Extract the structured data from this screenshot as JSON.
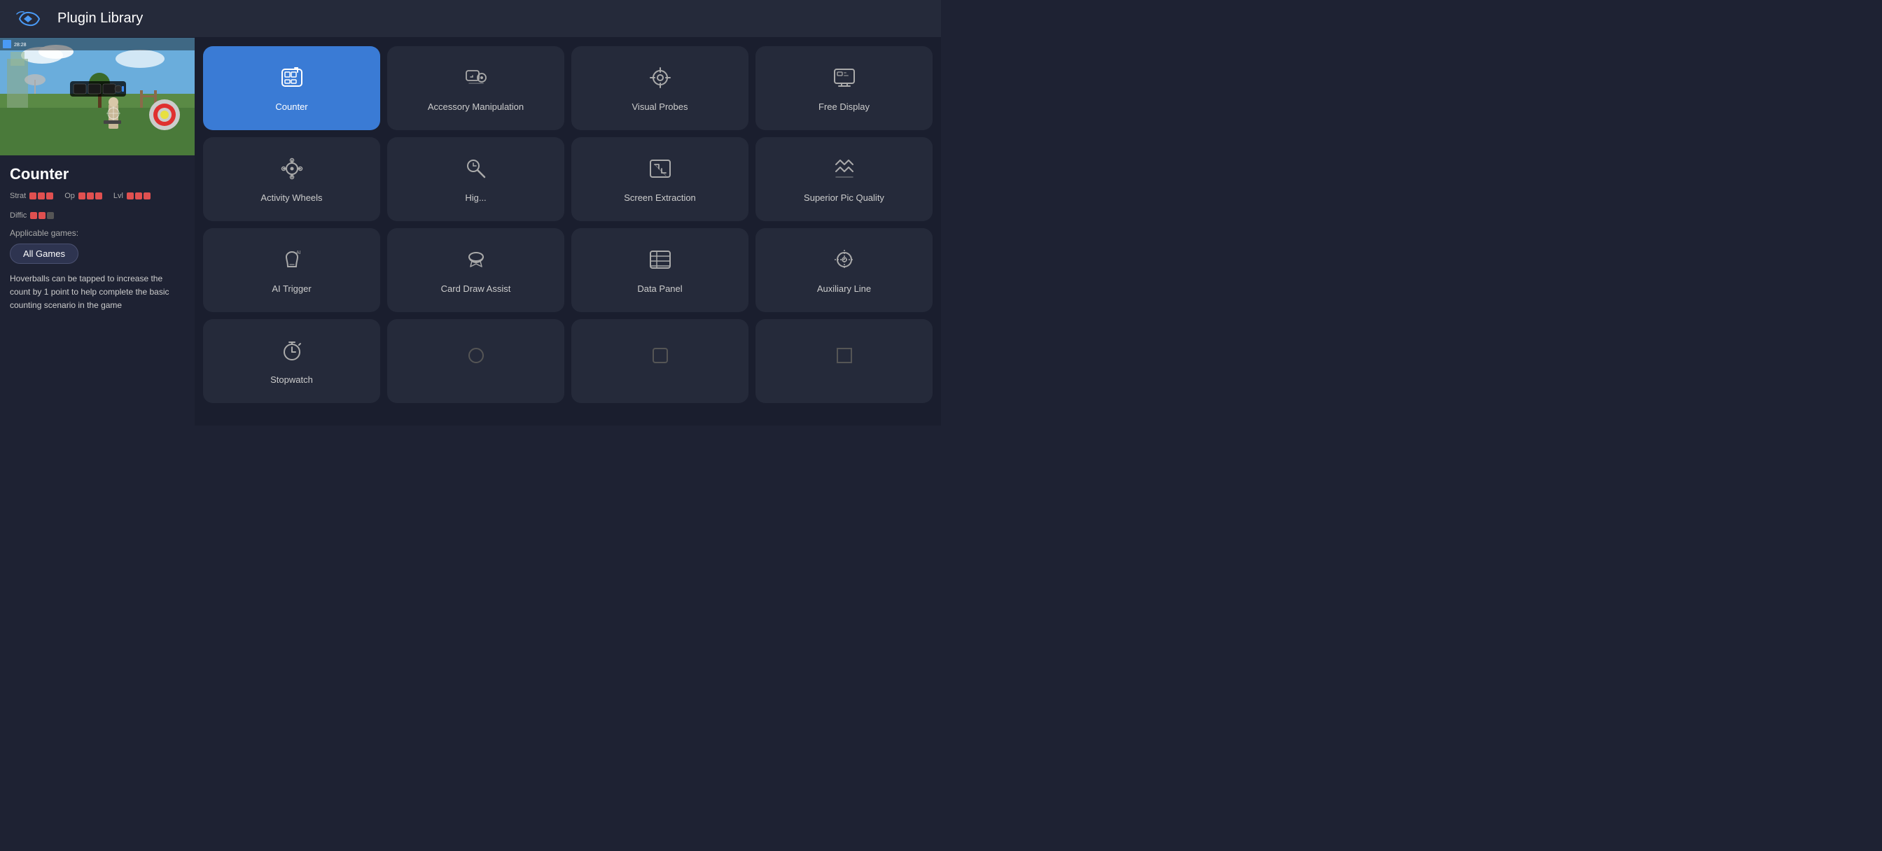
{
  "header": {
    "title": "Plugin Library"
  },
  "left": {
    "plugin_title": "Counter",
    "ratings": [
      {
        "label": "Strat",
        "dots": [
          true,
          true,
          true,
          false,
          false
        ]
      },
      {
        "label": "Op",
        "dots": [
          true,
          true,
          true,
          false,
          false
        ]
      },
      {
        "label": "Lvl",
        "dots": [
          true,
          true,
          true,
          false,
          false
        ]
      },
      {
        "label": "Diffic",
        "dots": [
          true,
          true,
          false,
          false,
          false
        ]
      }
    ],
    "applicable_label": "Applicable games:",
    "all_games_btn": "All Games",
    "description": "Hoverballs can be tapped to increase the count by 1 point to help complete the basic counting scenario in the game"
  },
  "grid": {
    "plugins": [
      {
        "id": "counter",
        "label": "Counter",
        "active": true,
        "icon": "counter"
      },
      {
        "id": "accessory-manipulation",
        "label": "Accessory Manipulation",
        "active": false,
        "icon": "accessory"
      },
      {
        "id": "visual-probes",
        "label": "Visual Probes",
        "active": false,
        "icon": "visual"
      },
      {
        "id": "free-display",
        "label": "Free Display",
        "active": false,
        "icon": "display"
      },
      {
        "id": "activity-wheels",
        "label": "Activity Wheels",
        "active": false,
        "icon": "wheels"
      },
      {
        "id": "hig",
        "label": "Hig...",
        "active": false,
        "icon": "hig"
      },
      {
        "id": "screen-extraction",
        "label": "Screen Extraction",
        "active": false,
        "icon": "extraction"
      },
      {
        "id": "superior-pic-quality",
        "label": "Superior Pic Quality",
        "active": false,
        "icon": "pic"
      },
      {
        "id": "ai-trigger",
        "label": "AI Trigger",
        "active": false,
        "icon": "ai"
      },
      {
        "id": "card-draw-assist",
        "label": "Card Draw Assist",
        "active": false,
        "icon": "card"
      },
      {
        "id": "data-panel",
        "label": "Data Panel",
        "active": false,
        "icon": "data"
      },
      {
        "id": "auxiliary-line",
        "label": "Auxiliary Line",
        "active": false,
        "icon": "auxiliary"
      },
      {
        "id": "stopwatch",
        "label": "Stopwatch",
        "active": false,
        "icon": "stopwatch"
      },
      {
        "id": "plugin-14",
        "label": "",
        "active": false,
        "icon": "generic1"
      },
      {
        "id": "plugin-15",
        "label": "",
        "active": false,
        "icon": "generic2"
      },
      {
        "id": "plugin-16",
        "label": "",
        "active": false,
        "icon": "generic3"
      }
    ]
  }
}
